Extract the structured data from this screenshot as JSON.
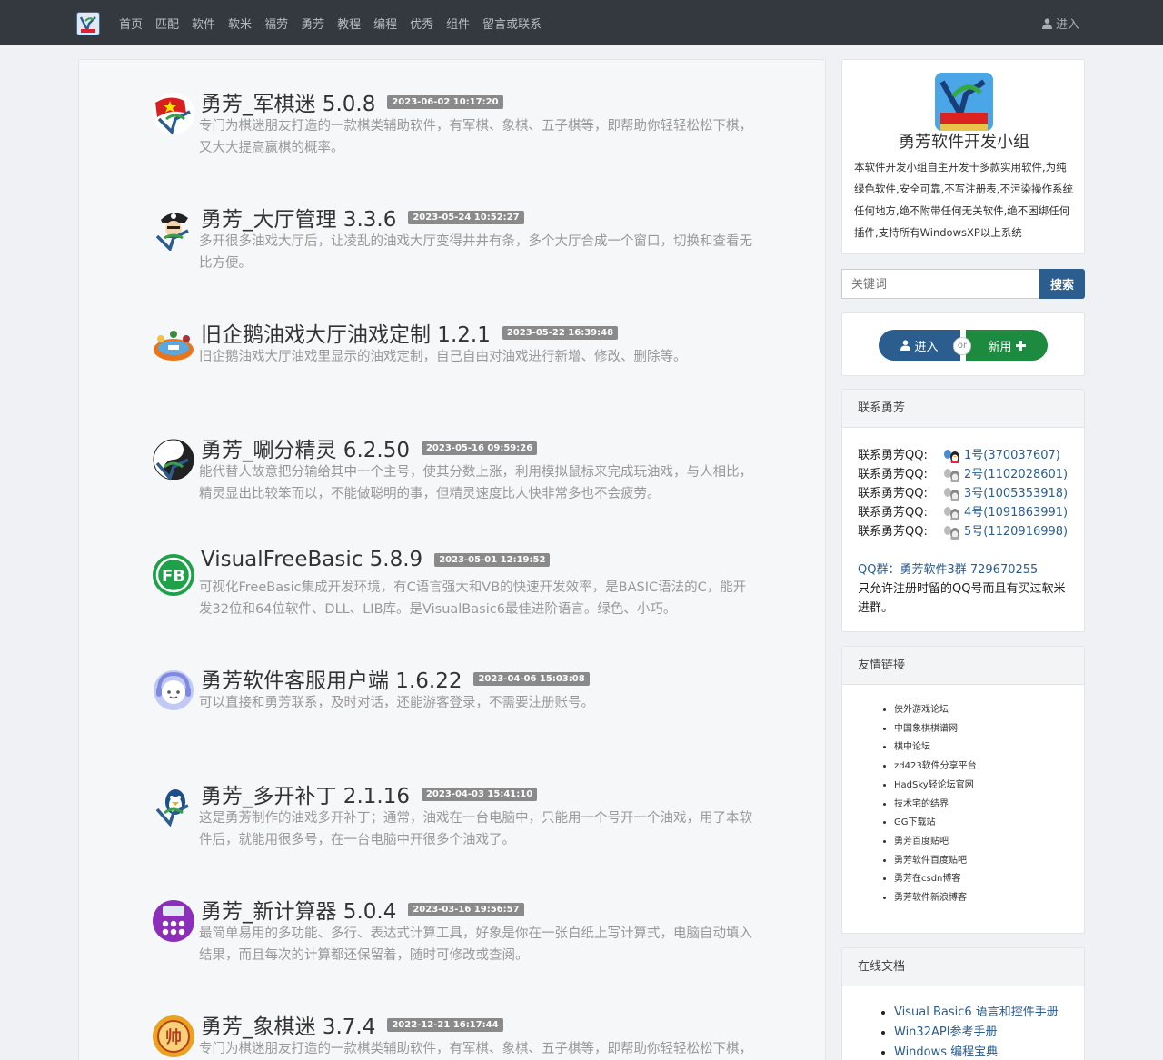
{
  "nav": {
    "links": [
      "首页",
      "匹配",
      "软件",
      "软米",
      "福劳",
      "勇芳",
      "教程",
      "编程",
      "优秀",
      "组件",
      "留言或联系"
    ],
    "login": "进入"
  },
  "items": [
    {
      "title": "勇芳_军棋迷 5.0.8",
      "date": "2023-06-02 10:17:20",
      "desc": "专门为棋迷朋友打造的一款棋类辅助软件，有军棋、象棋、五子棋等，即帮助你轻轻松松下棋，又大大提高赢棋的概率。",
      "icon": "junqi-flag-icon"
    },
    {
      "title": "勇芳_大厅管理 3.3.6",
      "date": "2023-05-24 10:52:27",
      "desc": "多开很多油戏大厅后，让凌乱的油戏大厅变得井井有条，多个大厅合成一个窗口，切换和查看无比方便。",
      "icon": "pirate-icon"
    },
    {
      "title": "旧企鹅油戏大厅油戏定制 1.2.1",
      "date": "2023-05-22 16:39:48",
      "desc": "旧企鹅油戏大厅油戏里显示的油戏定制，自己自由对油戏进行新增、修改、删除等。",
      "icon": "game-table-icon"
    },
    {
      "title": "勇芳_唰分精灵 6.2.50",
      "date": "2023-05-16 09:59:26",
      "desc": "能代替人故意把分输给其中一个主号，使其分数上涨，利用模拟鼠标来完成玩油戏，与人相比，精灵显出比较笨而以，不能做聪明的事，但精灵速度比人快非常多也不会疲劳。",
      "icon": "yinyang-icon"
    },
    {
      "title": "VisualFreeBasic 5.8.9",
      "date": "2023-05-01 12:19:52",
      "desc": "可视化FreeBasic集成开发环境，有C语言强大和VB的快速开发效率，是BASIC语法的C，能开发32位和64位软件、DLL、LIB库。是VisualBasic6最佳进阶语言。绿色、小巧。",
      "icon": "vfb-icon"
    },
    {
      "title": "勇芳软件客服用户端 1.6.22",
      "date": "2023-04-06 15:03:08",
      "desc": "可以直接和勇芳联系，及时对话，还能游客登录，不需要注册账号。",
      "icon": "customer-service-icon"
    },
    {
      "title": "勇芳_多开补丁 2.1.16",
      "date": "2023-04-03 15:41:10",
      "desc": "这是勇芳制作的油戏多开补丁；通常，油戏在一台电脑中，只能用一个号开一个油戏，用了本软件后，就能用很多号，在一台电脑中开很多个油戏了。",
      "icon": "penguin-icon"
    },
    {
      "title": "勇芳_新计算器 5.0.4",
      "date": "2023-03-16 19:56:57",
      "desc": "最简单易用的多功能、多行、表达式计算工具，好象是你在一张白纸上写计算式，电脑自动填入结果，而且每次的计算都还保留着，随时可修改或查阅。",
      "icon": "calculator-icon"
    },
    {
      "title": "勇芳_象棋迷 3.7.4",
      "date": "2022-12-21 16:17:44",
      "desc": "专门为棋迷朋友打造的一款棋类辅助软件，有军棋、象棋、五子棋等，即帮助你轻轻松松下棋，又大大提高赢棋的概率。",
      "icon": "xiangqi-icon"
    }
  ],
  "profile": {
    "name": "勇芳软件开发小组",
    "bio": "本软件开发小组自主开发十多款实用软件,为纯绿色软件,安全可靠,不写注册表,不污染操作系统任何地方,绝不附带任何无关软件,绝不困绑任何插件,支持所有WindowsXP以上系统"
  },
  "search": {
    "placeholder": "关键词",
    "button": "搜索"
  },
  "auth": {
    "enter": "进入",
    "or": "or",
    "new": "新用"
  },
  "contact": {
    "title": "联系勇芳",
    "label": "联系勇芳QQ:",
    "qq": [
      "1号(370037607)",
      "2号(1102028601)",
      "3号(1005353918)",
      "4号(1091863991)",
      "5号(1120916998)"
    ],
    "group": "QQ群：勇芳软件3群 729670255",
    "note": "只允许注册时留的QQ号而且有买过软米进群。"
  },
  "friends": {
    "title": "友情链接",
    "links": [
      "侠外游戏论坛",
      "中国象棋棋谱网",
      "棋中论坛",
      "zd423软件分享平台",
      "HadSky轻论坛官网",
      "技术宅的结界",
      "GG下载站",
      "勇芳百度贴吧",
      "勇芳软件百度贴吧",
      "勇芳在csdn博客",
      "勇芳软件新浪博客"
    ]
  },
  "docs": {
    "title": "在线文档",
    "links": [
      "Visual Basic6 语言和控件手册",
      "Win32API参考手册",
      "Windows 编程宝典"
    ]
  }
}
